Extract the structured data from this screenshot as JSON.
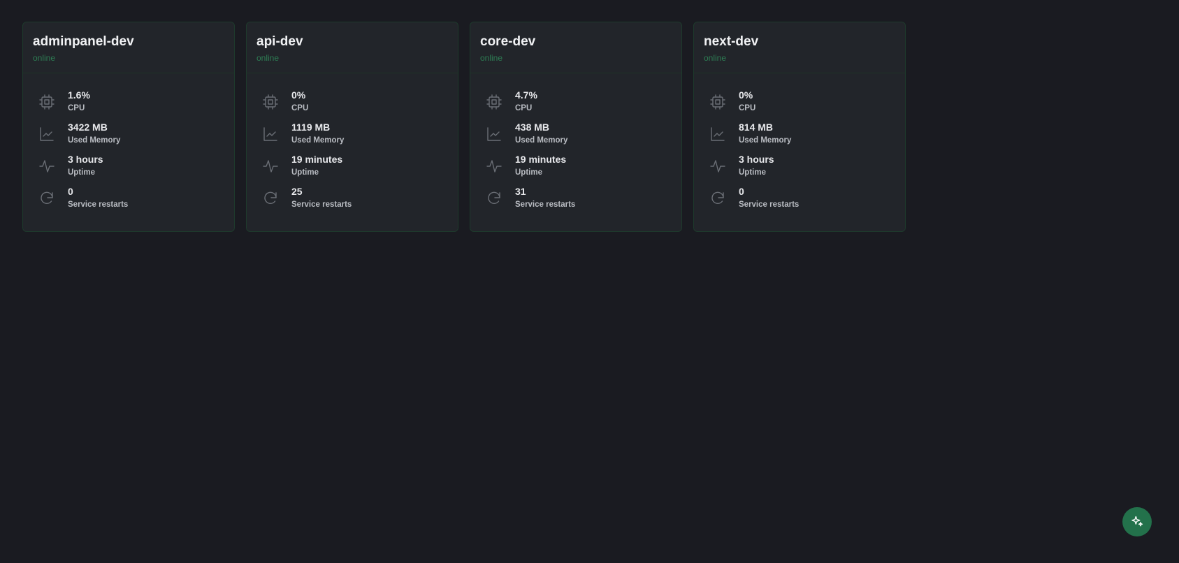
{
  "services": [
    {
      "name": "adminpanel-dev",
      "status": "online",
      "stats": {
        "cpu": {
          "value": "1.6%",
          "label": "CPU"
        },
        "memory": {
          "value": "3422 MB",
          "label": "Used Memory"
        },
        "uptime": {
          "value": "3 hours",
          "label": "Uptime"
        },
        "restarts": {
          "value": "0",
          "label": "Service restarts"
        }
      }
    },
    {
      "name": "api-dev",
      "status": "online",
      "stats": {
        "cpu": {
          "value": "0%",
          "label": "CPU"
        },
        "memory": {
          "value": "1119 MB",
          "label": "Used Memory"
        },
        "uptime": {
          "value": "19 minutes",
          "label": "Uptime"
        },
        "restarts": {
          "value": "25",
          "label": "Service restarts"
        }
      }
    },
    {
      "name": "core-dev",
      "status": "online",
      "stats": {
        "cpu": {
          "value": "4.7%",
          "label": "CPU"
        },
        "memory": {
          "value": "438 MB",
          "label": "Used Memory"
        },
        "uptime": {
          "value": "19 minutes",
          "label": "Uptime"
        },
        "restarts": {
          "value": "31",
          "label": "Service restarts"
        }
      }
    },
    {
      "name": "next-dev",
      "status": "online",
      "stats": {
        "cpu": {
          "value": "0%",
          "label": "CPU"
        },
        "memory": {
          "value": "814 MB",
          "label": "Used Memory"
        },
        "uptime": {
          "value": "3 hours",
          "label": "Uptime"
        },
        "restarts": {
          "value": "0",
          "label": "Service restarts"
        }
      }
    }
  ],
  "icons": {
    "cpu": "cpu-icon",
    "memory": "chart-line-icon",
    "uptime": "activity-icon",
    "restarts": "refresh-icon",
    "fab": "sparkles-icon"
  },
  "colors": {
    "background": "#1a1b21",
    "card": "#22252a",
    "status_online": "#2e7d54",
    "fab": "#23714b"
  }
}
